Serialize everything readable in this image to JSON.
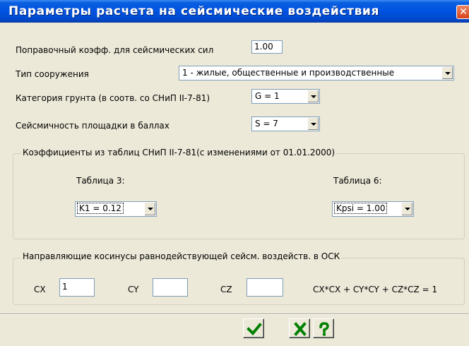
{
  "window": {
    "title": "Параметры расчета на сейсмические воздействия",
    "close_glyph": "✕"
  },
  "form": {
    "correction_label": "Поправочный коэфф. для сейсмических сил",
    "correction_value": "1.00",
    "structure_type_label": "Тип сооружения",
    "structure_type_value": "1 - жилые, общественные и производственные",
    "soil_category_label": "Категория грунта (в соотв. со СНиП II-7-81)",
    "soil_category_value": "G = 1",
    "seismicity_label": "Сейсмичность площадки в баллах",
    "seismicity_value": "S = 7"
  },
  "coefficients_group": {
    "title": "Коэффициенты из таблиц СНиП II-7-81(с изменениями от 01.01.2000)",
    "table3_label": "Таблица 3:",
    "table3_value": "K1 = 0.12",
    "table6_label": "Таблица 6:",
    "table6_value": "Kpsi = 1.00"
  },
  "cosines_group": {
    "title": "Направляющие косинусы равнодействующей сейсм. воздейств. в ОСК",
    "cx_label": "CX",
    "cx_value": "1",
    "cy_label": "CY",
    "cy_value": "",
    "cz_label": "CZ",
    "cz_value": "",
    "formula": "CX*CX + CY*CY + CZ*CZ = 1"
  },
  "buttons": [
    {
      "name": "ok-button",
      "icon": "check-icon",
      "color": "#008000"
    },
    {
      "name": "cancel-button",
      "icon": "x-icon",
      "color": "#008000"
    },
    {
      "name": "help-button",
      "icon": "question-icon",
      "color": "#008000"
    }
  ],
  "colors": {
    "titlebar": "#0053e1",
    "dialog_bg": "#ece9d8",
    "icon_green": "#008000",
    "close_red": "#d9441c"
  }
}
